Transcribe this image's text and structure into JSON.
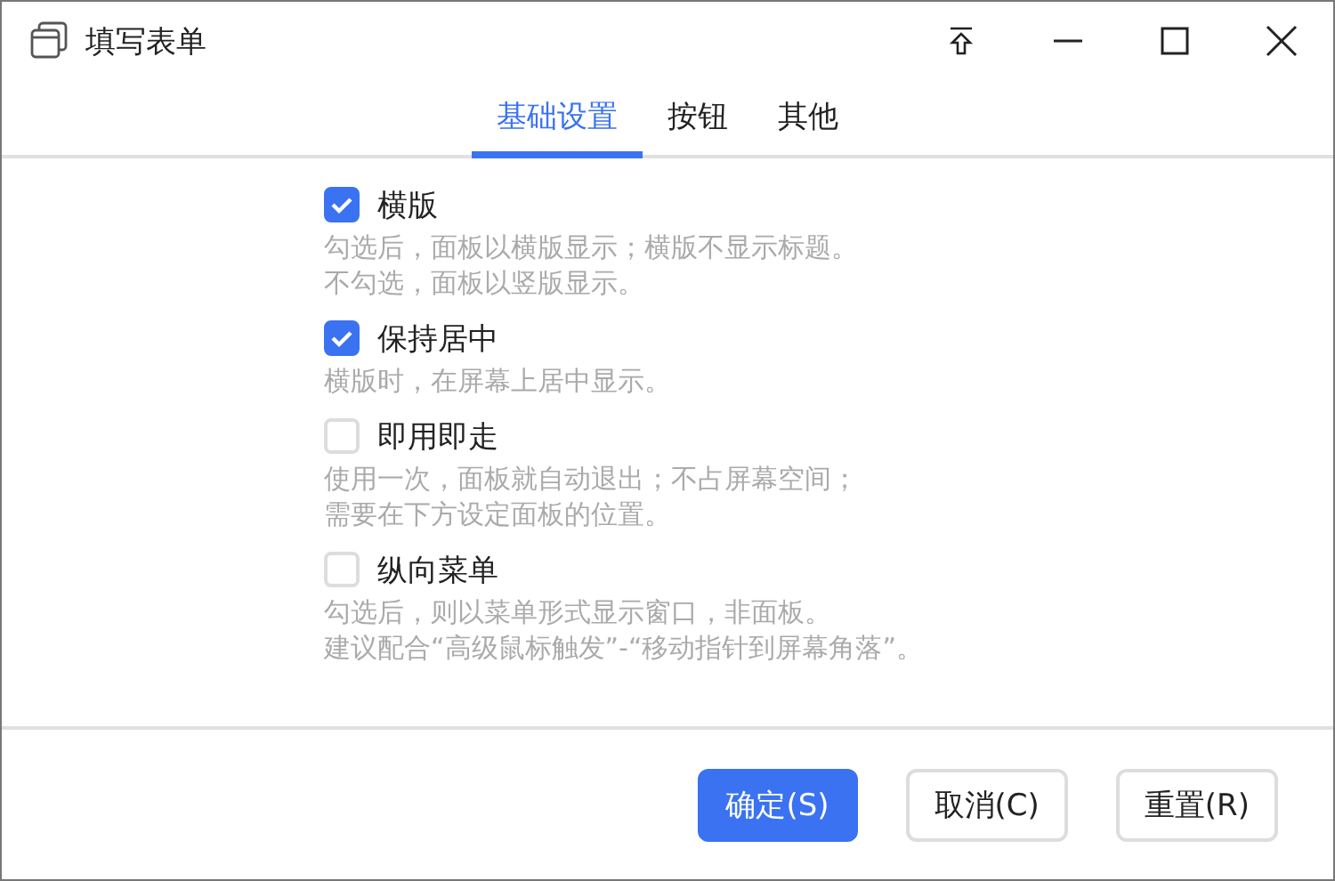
{
  "window": {
    "title": "填写表单"
  },
  "tabs": [
    {
      "label": "基础设置",
      "selected": true
    },
    {
      "label": "按钮",
      "selected": false
    },
    {
      "label": "其他",
      "selected": false
    }
  ],
  "options": [
    {
      "label": "横版",
      "checked": true,
      "description": [
        "勾选后，面板以横版显示；横版不显示标题。",
        "不勾选，面板以竖版显示。"
      ]
    },
    {
      "label": "保持居中",
      "checked": true,
      "description": [
        "横版时，在屏幕上居中显示。"
      ]
    },
    {
      "label": "即用即走",
      "checked": false,
      "description": [
        "使用一次，面板就自动退出；不占屏幕空间；",
        "需要在下方设定面板的位置。"
      ]
    },
    {
      "label": "纵向菜单",
      "checked": false,
      "description": [
        "勾选后，则以菜单形式显示窗口，非面板。",
        "建议配合“高级鼠标触发”-“移动指针到屏幕角落”。"
      ]
    }
  ],
  "buttons": [
    {
      "label": "确定(S)",
      "kind": "primary"
    },
    {
      "label": "取消(C)",
      "kind": "default"
    },
    {
      "label": "重置(R)",
      "kind": "default"
    }
  ]
}
